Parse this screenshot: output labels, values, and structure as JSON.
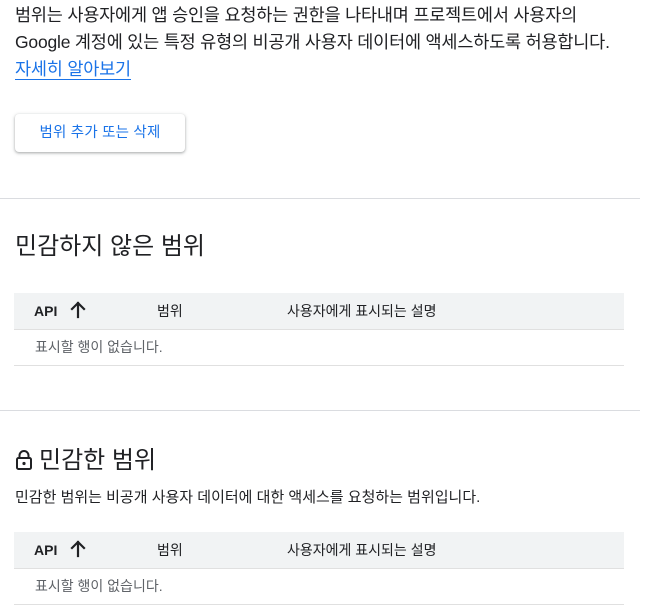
{
  "intro": {
    "text": "범위는 사용자에게 앱 승인을 요청하는 권한을 나타내며 프로젝트에서 사용자의 Google 계정에 있는 특정 유형의 비공개 사용자 데이터에 액세스하도록 허용합니다. ",
    "link_label": "자세히 알아보기"
  },
  "actions": {
    "add_remove_label": "범위 추가 또는 삭제"
  },
  "non_sensitive": {
    "heading": "민감하지 않은 범위",
    "table": {
      "columns": [
        "API",
        "범위",
        "사용자에게 표시되는 설명"
      ],
      "sort_icon": "arrow-up-icon",
      "empty_text": "표시할 행이 없습니다."
    }
  },
  "sensitive": {
    "icon": "lock-icon",
    "heading": "민감한 범위",
    "description": "민감한 범위는 비공개 사용자 데이터에 대한 액세스를 요청하는 범위입니다.",
    "table": {
      "columns": [
        "API",
        "범위",
        "사용자에게 표시되는 설명"
      ],
      "sort_icon": "arrow-up-icon",
      "empty_text": "표시할 행이 없습니다."
    }
  },
  "colors": {
    "link": "#1a73e8",
    "text": "#202124",
    "header_bg": "#f1f3f4",
    "divider": "#dadce0"
  }
}
